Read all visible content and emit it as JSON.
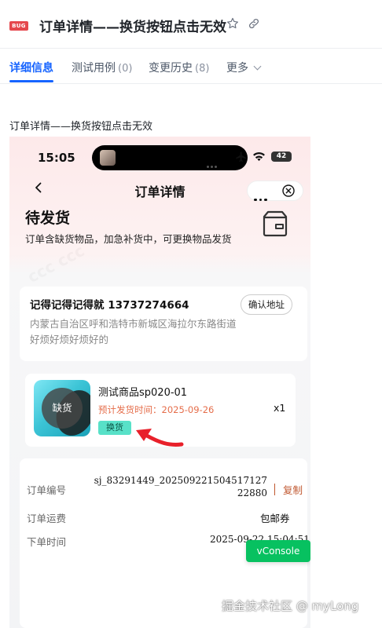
{
  "header": {
    "badge": "BUG",
    "title": "订单详情——换货按钮点击无效",
    "star_icon": "star-icon",
    "link_icon": "link-icon"
  },
  "tabs": [
    {
      "label": "详细信息",
      "count": ""
    },
    {
      "label": "测试用例",
      "count": "(0)"
    },
    {
      "label": "变更历史",
      "count": "(8)"
    },
    {
      "label": "更多",
      "count": ""
    }
  ],
  "description": "订单详情——换货按钮点击无效",
  "phone": {
    "status_bar": {
      "time": "15:05",
      "battery": "42"
    },
    "nav": {
      "title": "订单详情"
    },
    "order_status": {
      "title": "待发货",
      "desc": "订单含缺货物品，加急补货中，可更换物品发货"
    },
    "address": {
      "name_phone": "记得记得记得就 13737274664",
      "detail": "内蒙古自治区呼和浩特市新城区海拉尔东路街道好烦好烦好烦好的",
      "confirm_label": "确认地址"
    },
    "goods": {
      "out_of_stock": "缺货",
      "name": "测试商品sp020-01",
      "ship_time": "预计发货时间：2025-09-26",
      "qty": "x1",
      "exchange_label": "换货"
    },
    "order": {
      "no_label": "订单编号",
      "no_value": "sj_83291449_20250922150451712722880",
      "copy_label": "复制",
      "shipping_label": "订单运费",
      "shipping_value": "包邮券",
      "time_label": "下单时间",
      "time_value": "2025-09-22 15:04:51"
    },
    "vconsole_label": "vConsole"
  },
  "watermark": "掘金技术社区 @ myLong",
  "colors": {
    "accent": "#1664ff",
    "bug_badge": "#e5484d",
    "exchange_tag": "#58e1c8",
    "ship_time": "#e56d4a",
    "copy": "#c0572f",
    "vconsole": "#07c160",
    "arrow": "#e8202a"
  }
}
